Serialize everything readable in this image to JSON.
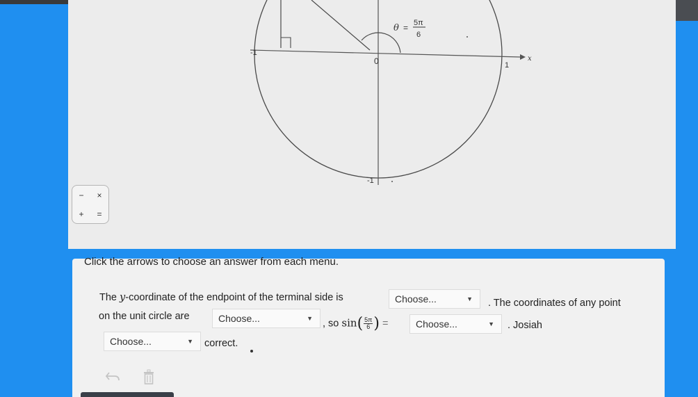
{
  "figure": {
    "angle_label_theta": "θ",
    "angle_label_eq": "=",
    "angle_num": "5π",
    "angle_den": "6",
    "label_neg1_x": "-1",
    "label_zero": "0",
    "label_one": "1",
    "label_x_axis": "x",
    "label_neg1_y": "-1"
  },
  "keypad": {
    "keys": [
      "−",
      "×",
      "+",
      "="
    ]
  },
  "question": {
    "instruction": "Click the arrows to choose an answer from each menu.",
    "sentence1_prefix": "The",
    "sentence1_var": "y",
    "sentence1_mid": "-coordinate of the endpoint of the terminal side is",
    "select1": "Choose...",
    "sentence1_suffix": ". The coordinates of any point",
    "sentence2_prefix": "on the unit circle are",
    "select2": "Choose...",
    "sentence2_so": ", so",
    "sin_fn": "sin",
    "sin_num": "5π",
    "sin_den": "6",
    "equals": "=",
    "select3": "Choose...",
    "sentence2_suffix": ". Josiah",
    "select4": "Choose...",
    "sentence3_suffix": "correct."
  },
  "tools": {
    "undo_icon": "undo-arrow-icon",
    "trash_icon": "trash-icon"
  }
}
